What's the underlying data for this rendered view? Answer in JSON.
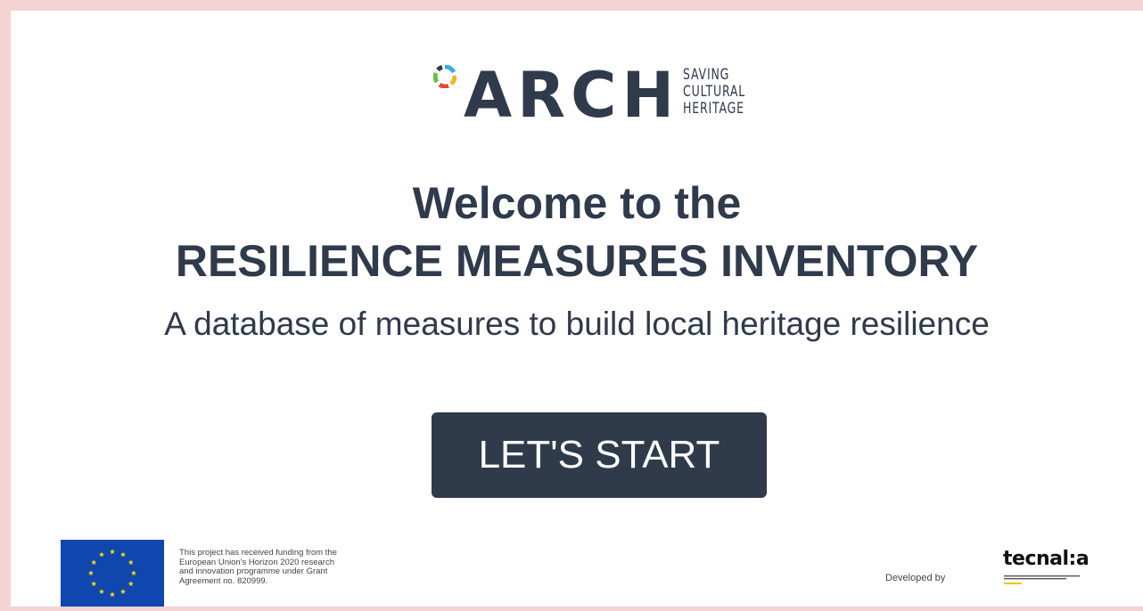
{
  "logo": {
    "brand": "ARCH",
    "tagline": [
      "SAVING",
      "CULTURAL",
      "HERITAGE"
    ],
    "icon": "arch-ring-logo-icon"
  },
  "hero": {
    "welcome": "Welcome to the",
    "title": "RESILIENCE MEASURES INVENTORY",
    "subtitle": "A database of measures to build local heritage resilience"
  },
  "cta": {
    "label": "LET'S START"
  },
  "footer": {
    "funding_lines": [
      "This project has received funding from the",
      "European Union's Horizon 2020 research",
      "and innovation programme under Grant",
      "Agreement no. 820999."
    ],
    "developed_by": "Developed by",
    "developer_logo": "tecnal:a",
    "eu_flag_icon": "eu-flag-icon"
  },
  "colors": {
    "page_border": "#f6d3d3",
    "navy": "#2f3a4b",
    "eu_blue": "#0f47af",
    "eu_yellow": "#ffdd00",
    "tecnalia_yellow": "#f5c400"
  }
}
